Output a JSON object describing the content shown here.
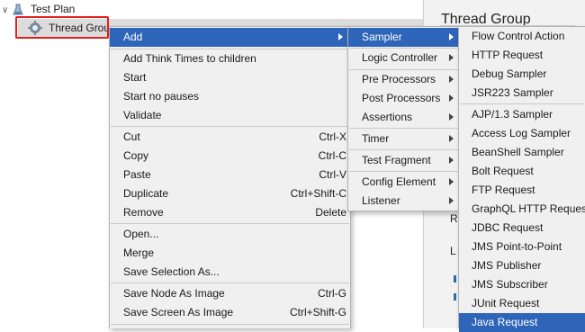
{
  "tree": {
    "test_plan": "Test Plan",
    "thread_group": "Thread Grou"
  },
  "right_panel": {
    "title": "Thread Group",
    "letter_r": "R",
    "letter_l": "L"
  },
  "context_menu": {
    "items": [
      {
        "label": "Add",
        "accel": "",
        "submenu": true,
        "selected": true
      },
      {
        "label": "Add Think Times to children",
        "accel": ""
      },
      {
        "label": "Start",
        "accel": ""
      },
      {
        "label": "Start no pauses",
        "accel": ""
      },
      {
        "label": "Validate",
        "accel": ""
      },
      {
        "label": "Cut",
        "accel": "Ctrl-X"
      },
      {
        "label": "Copy",
        "accel": "Ctrl-C"
      },
      {
        "label": "Paste",
        "accel": "Ctrl-V"
      },
      {
        "label": "Duplicate",
        "accel": "Ctrl+Shift-C"
      },
      {
        "label": "Remove",
        "accel": "Delete"
      },
      {
        "label": "Open...",
        "accel": ""
      },
      {
        "label": "Merge",
        "accel": ""
      },
      {
        "label": "Save Selection As...",
        "accel": ""
      },
      {
        "label": "Save Node As Image",
        "accel": "Ctrl-G"
      },
      {
        "label": "Save Screen As Image",
        "accel": "Ctrl+Shift-G"
      }
    ]
  },
  "add_submenu": {
    "items": [
      {
        "label": "Sampler",
        "selected": true
      },
      {
        "label": "Logic Controller"
      },
      {
        "label": "Pre Processors"
      },
      {
        "label": "Post Processors"
      },
      {
        "label": "Assertions"
      },
      {
        "label": "Timer"
      },
      {
        "label": "Test Fragment"
      },
      {
        "label": "Config Element"
      },
      {
        "label": "Listener"
      }
    ]
  },
  "sampler_submenu": {
    "items": [
      {
        "label": "Flow Control Action"
      },
      {
        "label": "HTTP Request"
      },
      {
        "label": "Debug Sampler"
      },
      {
        "label": "JSR223 Sampler"
      },
      {
        "label": "AJP/1.3 Sampler"
      },
      {
        "label": "Access Log Sampler"
      },
      {
        "label": "BeanShell Sampler"
      },
      {
        "label": "Bolt Request"
      },
      {
        "label": "FTP Request"
      },
      {
        "label": "GraphQL HTTP Request"
      },
      {
        "label": "JDBC Request"
      },
      {
        "label": "JMS Point-to-Point"
      },
      {
        "label": "JMS Publisher"
      },
      {
        "label": "JMS Subscriber"
      },
      {
        "label": "JUnit Request"
      },
      {
        "label": "Java Request",
        "selected": true
      }
    ]
  },
  "colors": {
    "selection": "#2f65b8",
    "highlight_border": "#e11d1d",
    "menu_bg": "#f0f0f0"
  }
}
